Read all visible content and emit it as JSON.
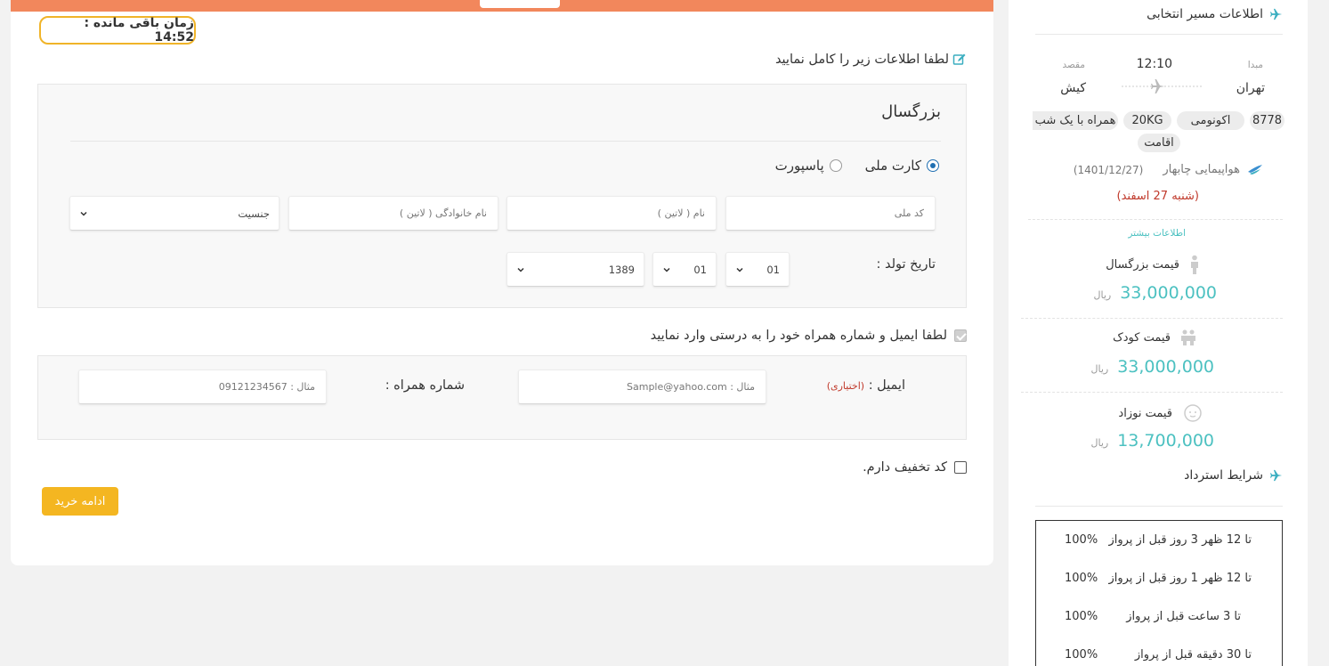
{
  "timer": {
    "label": "زمان باقی مانده : 14:52"
  },
  "form": {
    "heading": "لطفا اطلاعات زیر را کامل نمایید",
    "passenger": {
      "title": "بزرگسال",
      "id_type_options": [
        "کارت ملی",
        "پاسپورت"
      ],
      "id_type_selected": "کارت ملی",
      "national_code_placeholder": "کد ملی",
      "first_name_placeholder": "نام ( لاتین )",
      "last_name_placeholder": "نام خانوادگی ( لاتین )",
      "gender_label": "جنسیت",
      "birth_date_label": "تاریخ تولد :",
      "birth_day": "01",
      "birth_month": "01",
      "birth_year": "1389"
    },
    "contact": {
      "heading": "لطفا ایمیل و شماره همراه خود را به درستی وارد نمایید",
      "email_label": "ایمیل :",
      "email_optional": "(اختیاری)",
      "email_placeholder": "مثال : Sample@yahoo.com",
      "mobile_label": "شماره همراه :",
      "mobile_placeholder": "مثال : 09121234567"
    },
    "discount_label": "کد تخفیف دارم.",
    "continue_label": "ادامه خرید"
  },
  "sidebar": {
    "route_title": "اطلاعات مسیر انتخابی",
    "origin_caption": "مبدا",
    "destination_caption": "مقصد",
    "departure_time": "12:10",
    "origin_city": "تهران",
    "destination_city": "کیش",
    "badges": [
      "8778",
      "اکونومی",
      "20KG",
      "همراه با یک شب",
      "اقامت"
    ],
    "airline": "هواپیمایی چابهار",
    "flight_date": "(1401/12/27)",
    "flight_day": "(شنبه 27 اسفند)",
    "more_info": "اطلاعات بیشتر",
    "prices": [
      {
        "label": "قیمت بزرگسال",
        "amount": "33,000,000",
        "currency": "ریال"
      },
      {
        "label": "قیمت کودک",
        "amount": "33,000,000",
        "currency": "ریال"
      },
      {
        "label": "قیمت نوزاد",
        "amount": "13,700,000",
        "currency": "ریال"
      }
    ],
    "refund_title": "شرایط استرداد",
    "refund_rows": [
      {
        "condition": "تا 12 ظهر 3 روز قبل از پرواز",
        "percent": "100%"
      },
      {
        "condition": "تا 12 ظهر 1 روز قبل از پرواز",
        "percent": "100%"
      },
      {
        "condition": "تا 3 ساعت قبل از پرواز",
        "percent": "100%"
      },
      {
        "condition": "تا 30 دقیقه قبل از پرواز",
        "percent": "100%"
      }
    ]
  },
  "colors": {
    "top_bar": "#f2875c",
    "timer_border": "#f0b429",
    "button": "#f4b621",
    "accent_teal": "#4cc1c1",
    "radio_blue": "#1f6fb2",
    "warning_red": "#c0392b"
  }
}
